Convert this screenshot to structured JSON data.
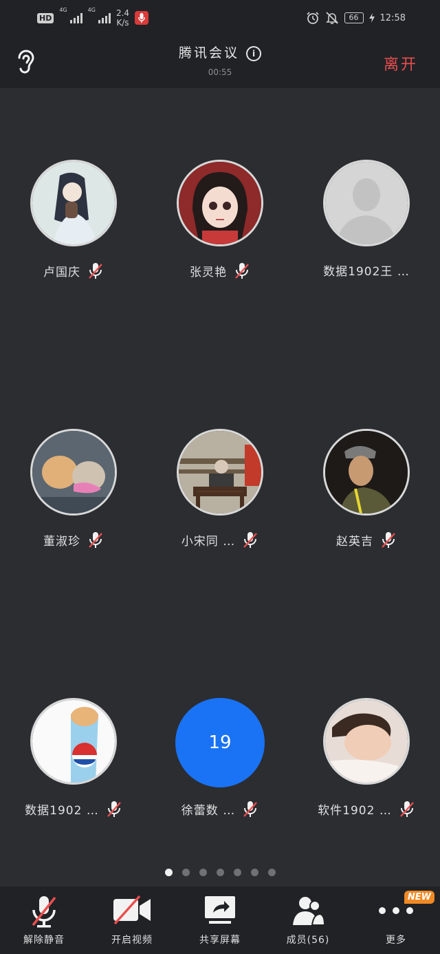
{
  "status_bar": {
    "hd_label": "HD",
    "net1": "4G",
    "net2": "4G",
    "speed_value": "2.4",
    "speed_unit": "K/s",
    "battery": "66",
    "time": "12:58"
  },
  "header": {
    "title": "腾讯会议",
    "info_symbol": "i",
    "timer": "00:55",
    "leave_label": "离开"
  },
  "participants": [
    {
      "name": "卢国庆",
      "muted": true
    },
    {
      "name": "张灵艳",
      "muted": true
    },
    {
      "name": "数据1902王 …",
      "muted": false
    },
    {
      "name": "董淑珍",
      "muted": true
    },
    {
      "name": "小宋同 …",
      "muted": true
    },
    {
      "name": "赵英吉",
      "muted": true
    },
    {
      "name": "数据1902 …",
      "muted": true
    },
    {
      "name": "徐蕾数 …",
      "muted": true,
      "avatar_text": "19"
    },
    {
      "name": "软件1902 …",
      "muted": true
    }
  ],
  "pagination": {
    "pages": 7,
    "active": 1
  },
  "toolbar": {
    "unmute_label": "解除静音",
    "video_label": "开启视频",
    "share_label": "共享屏幕",
    "members_label": "成员(56)",
    "more_label": "更多",
    "new_badge": "NEW"
  },
  "colors": {
    "background": "#2b2d31",
    "bar": "#212226",
    "leave": "#e94f4f",
    "mute_slash": "#e94f4f",
    "number_avatar": "#1a73f5",
    "new_badge": "#f08a24"
  }
}
